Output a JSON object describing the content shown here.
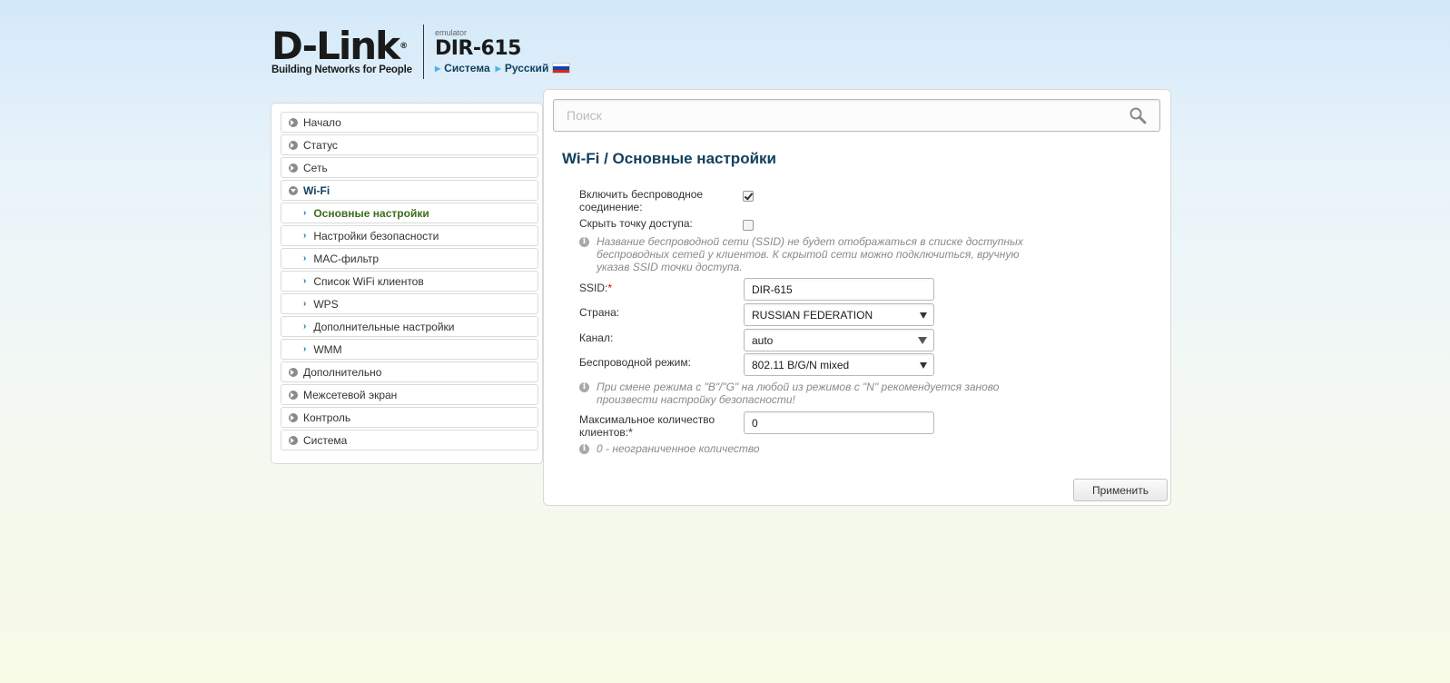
{
  "header": {
    "logo": "D-Link",
    "logo_reg": "®",
    "tagline": "Building Networks for People",
    "emulator_label": "emulator",
    "model": "DIR-615",
    "links": [
      "Система",
      "Русский"
    ],
    "flag_colors": [
      "#ffffff",
      "#1c3fa8",
      "#d52b1e"
    ]
  },
  "sidebar": {
    "items": [
      {
        "label": "Начало",
        "type": "top"
      },
      {
        "label": "Статус",
        "type": "top"
      },
      {
        "label": "Сеть",
        "type": "top"
      },
      {
        "label": "Wi-Fi",
        "type": "open"
      },
      {
        "label": "Основные настройки",
        "type": "sub-active"
      },
      {
        "label": "Настройки безопасности",
        "type": "sub"
      },
      {
        "label": "MAC-фильтр",
        "type": "sub"
      },
      {
        "label": "Список WiFi клиентов",
        "type": "sub"
      },
      {
        "label": "WPS",
        "type": "sub"
      },
      {
        "label": "Дополнительные настройки",
        "type": "sub"
      },
      {
        "label": "WMM",
        "type": "sub"
      },
      {
        "label": "Дополнительно",
        "type": "top"
      },
      {
        "label": "Межсетевой экран",
        "type": "top"
      },
      {
        "label": "Контроль",
        "type": "top"
      },
      {
        "label": "Система",
        "type": "top"
      }
    ]
  },
  "search": {
    "placeholder": "Поиск",
    "icon": "search-icon"
  },
  "page": {
    "title": "Wi-Fi /  Основные настройки"
  },
  "form": {
    "enable_wireless": {
      "label_line1": "Включить беспроводное",
      "label_line2": "соединение:",
      "checked": true
    },
    "hide_ap": {
      "label": "Скрыть точку доступа:",
      "checked": false
    },
    "hint_ssid": [
      "Название беспроводной сети (SSID) не будет отображаться в списке доступных",
      "беспроводных сетей у клиентов. К скрытой сети можно подключиться, вручную",
      "указав SSID точки доступа."
    ],
    "ssid": {
      "label": "SSID:",
      "required_mark": "*",
      "value": "DIR-615"
    },
    "country": {
      "label": "Страна:",
      "value": "RUSSIAN FEDERATION"
    },
    "channel": {
      "label": "Канал:",
      "value": "auto"
    },
    "mode": {
      "label": "Беспроводной режим:",
      "value": "802.11 B/G/N mixed"
    },
    "hint_mode": [
      "При смене режима с \"B\"/\"G\" на любой из режимов с \"N\" рекомендуется заново",
      "произвести настройку безопасности!"
    ],
    "max_clients": {
      "label_line1": "Максимальное количество",
      "label_line2": "клиентов:*",
      "value": "0"
    },
    "hint_max": "0 - неограниченное количество",
    "info_icon_glyph": "i"
  },
  "buttons": {
    "apply": "Применить"
  },
  "colors": {
    "title": "#12405f",
    "active_menu": "#3c6e1d",
    "required": "#dd0000"
  }
}
